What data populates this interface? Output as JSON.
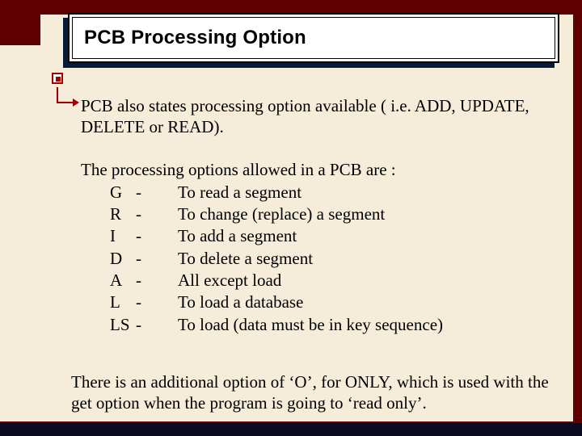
{
  "title": "PCB Processing Option",
  "intro": "PCB also states processing option available ( i.e. ADD, UPDATE, DELETE or READ).",
  "lead": "The processing options allowed in a PCB are :",
  "options": [
    {
      "code": "G",
      "dash": "-",
      "desc": "To read a segment"
    },
    {
      "code": "R",
      "dash": "-",
      "desc": "To change (replace) a segment"
    },
    {
      "code": "I",
      "dash": "-",
      "desc": "To add a segment"
    },
    {
      "code": "D",
      "dash": "-",
      "desc": "To delete  a segment"
    },
    {
      "code": "A",
      "dash": "-",
      "desc": "All except load"
    },
    {
      "code": "L",
      "dash": "-",
      "desc": "To load a database"
    },
    {
      "code": "LS",
      "dash": "-",
      "desc": "To load (data must be in key sequence)"
    }
  ],
  "closing": "There is an additional option of ‘O’, for ONLY, which is used with the get option when the program is going to ‘read only’."
}
